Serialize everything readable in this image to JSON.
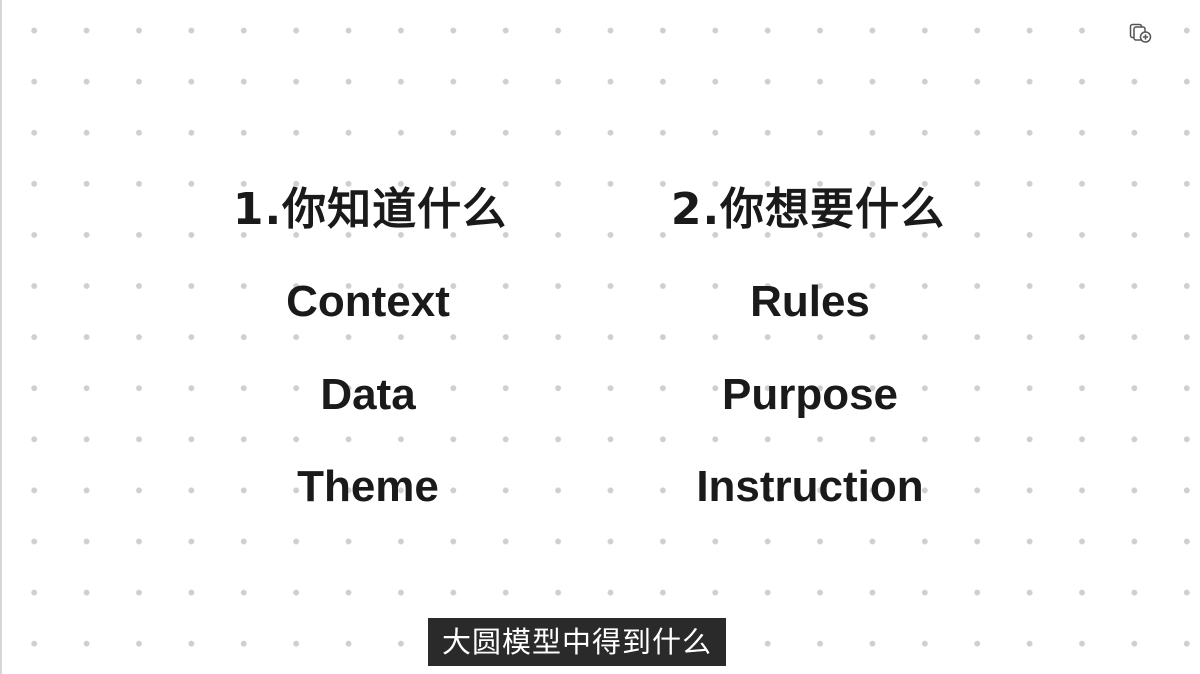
{
  "left_column": {
    "heading": "1.你知道什么",
    "items": [
      "Context",
      "Data",
      "Theme"
    ]
  },
  "right_column": {
    "heading": "2.你想要什么",
    "items": [
      "Rules",
      "Purpose",
      "Instruction"
    ]
  },
  "subtitle": "大圆模型中得到什么",
  "corner_icon": "cards-add-icon",
  "colors": {
    "background": "#ffffff",
    "dot": "#cfcfcf",
    "text": "#1a1a1a",
    "subtitle_bg": "#2a2a2a",
    "subtitle_text": "#ffffff"
  }
}
